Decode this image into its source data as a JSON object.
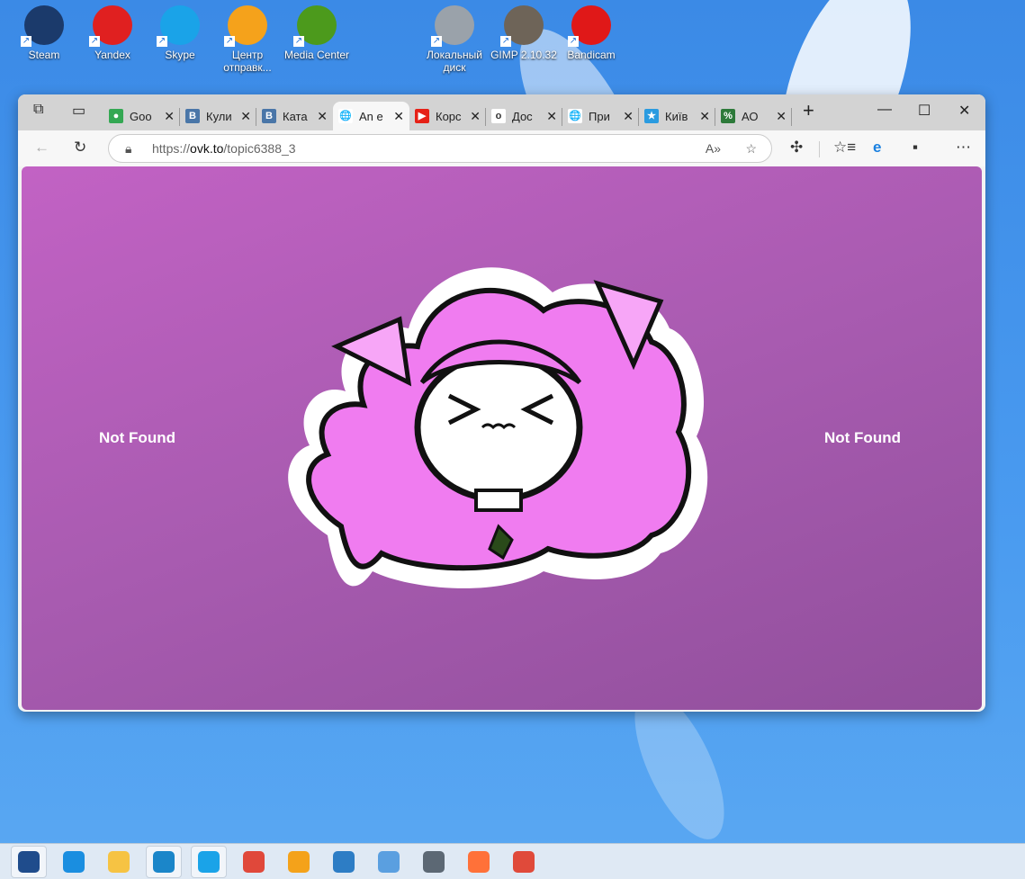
{
  "desktop": {
    "icons": [
      {
        "label": "Steam",
        "color": "#1b3a6b"
      },
      {
        "label": "Yandex",
        "color": "#e02020"
      },
      {
        "label": "Skype",
        "color": "#1aa3e8"
      },
      {
        "label": "Центр отправк...",
        "color": "#f5a21b"
      },
      {
        "label": "Media Center",
        "color": "#4c9a1c"
      },
      {
        "label": "Локальный диск",
        "color": "#9aa2aa"
      },
      {
        "label": "GIMP 2.10.32",
        "color": "#6e6458"
      },
      {
        "label": "Bandicam",
        "color": "#e01818"
      }
    ]
  },
  "browser": {
    "tabs": [
      {
        "title": "Goo",
        "icon": "google-maps-icon",
        "color": "#34a853"
      },
      {
        "title": "Кули",
        "icon": "vk-icon",
        "color": "#4a76a8",
        "glyph": "В"
      },
      {
        "title": "Ката",
        "icon": "vk-icon",
        "color": "#4a76a8",
        "glyph": "В"
      },
      {
        "title": "An e",
        "icon": "globe-icon",
        "color": "#ffffff",
        "glyph": "🌐",
        "active": true
      },
      {
        "title": "Корс",
        "icon": "youtube-icon",
        "color": "#e62117",
        "glyph": "▶"
      },
      {
        "title": "Дос",
        "icon": "olx-icon",
        "color": "#ffffff",
        "glyph": "o"
      },
      {
        "title": "При",
        "icon": "globe-icon",
        "color": "#ffffff",
        "glyph": "🌐"
      },
      {
        "title": "Київ",
        "icon": "kyiv-star-icon",
        "color": "#2a9be0",
        "glyph": "★"
      },
      {
        "title": "АО",
        "icon": "site-icon",
        "color": "#2d7a3a",
        "glyph": "%"
      }
    ],
    "url_scheme": "https://",
    "url_host": "ovk.to",
    "url_path": "/topic6388_3"
  },
  "page": {
    "left_text": "Not Found",
    "right_text": "Not Found"
  },
  "taskbar": {
    "apps": [
      {
        "name": "store",
        "color": "#1f4c8c",
        "active": true
      },
      {
        "name": "mail",
        "color": "#1a8ee0"
      },
      {
        "name": "file-explorer",
        "color": "#f6c343"
      },
      {
        "name": "edge",
        "color": "#1b86c9",
        "active": true
      },
      {
        "name": "skype",
        "color": "#1aa3e8",
        "active": true
      },
      {
        "name": "chrome",
        "color": "#e0483a"
      },
      {
        "name": "weather",
        "color": "#f4a21a"
      },
      {
        "name": "photos",
        "color": "#2d7dc5"
      },
      {
        "name": "paint",
        "color": "#5a9fe0"
      },
      {
        "name": "calculator",
        "color": "#5c6874"
      },
      {
        "name": "firefox",
        "color": "#ff7139"
      },
      {
        "name": "snipping-tool",
        "color": "#e04a3a"
      }
    ]
  }
}
